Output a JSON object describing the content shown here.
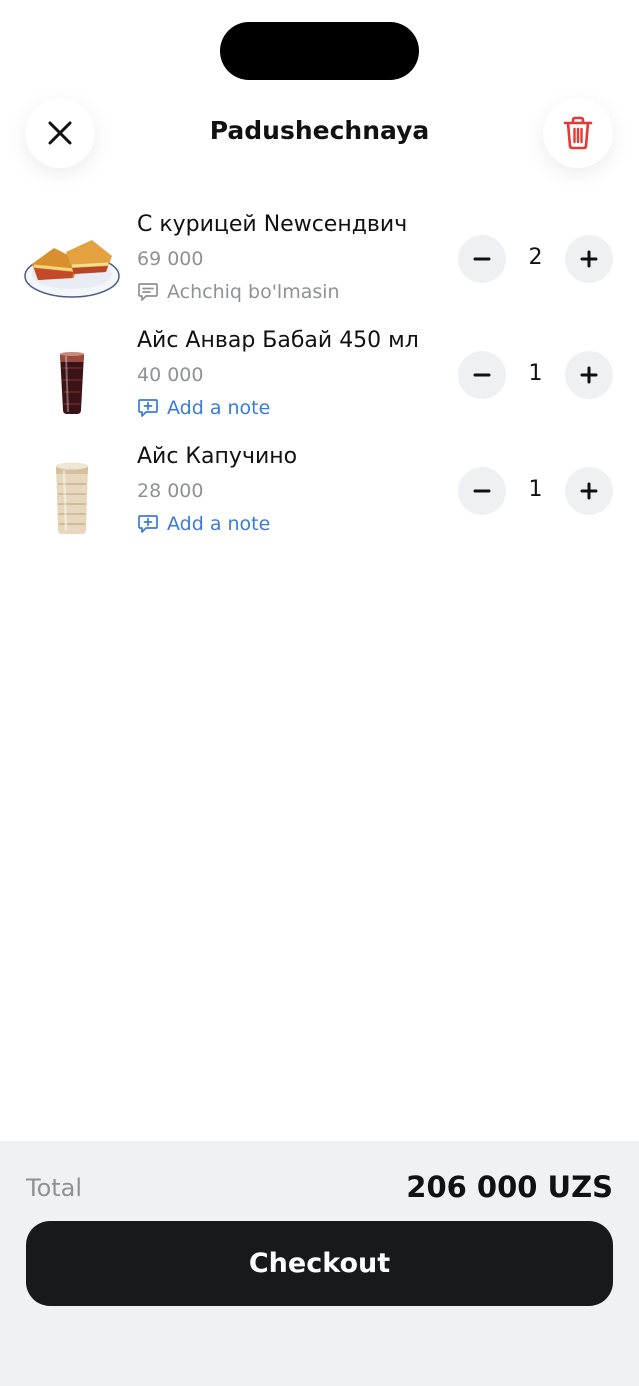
{
  "header": {
    "title": "Padushechnaya",
    "close_icon": "close-icon",
    "trash_icon": "trash-icon"
  },
  "items": [
    {
      "name": "С курицей Newсендвич",
      "price": "69 000",
      "note": "Achchiq bo'lmasin",
      "quantity": "2",
      "image": "sandwich"
    },
    {
      "name": "Айс Анвар Бабай 450 мл",
      "price": "40 000",
      "note": "Add a note",
      "quantity": "1",
      "image": "iced-cola-glass"
    },
    {
      "name": "Айс Капучино",
      "price": "28 000",
      "note": "Add a note",
      "quantity": "1",
      "image": "iced-cappuccino-cup"
    }
  ],
  "footer": {
    "total_label": "Total",
    "total_value": "206 000 UZS",
    "checkout_label": "Checkout"
  },
  "colors": {
    "accent_link": "#3a7bd5",
    "trash_red": "#e53935",
    "checkout_bg": "#18191b",
    "footer_bg": "#f0f1f3",
    "muted_text": "#8f9196"
  }
}
